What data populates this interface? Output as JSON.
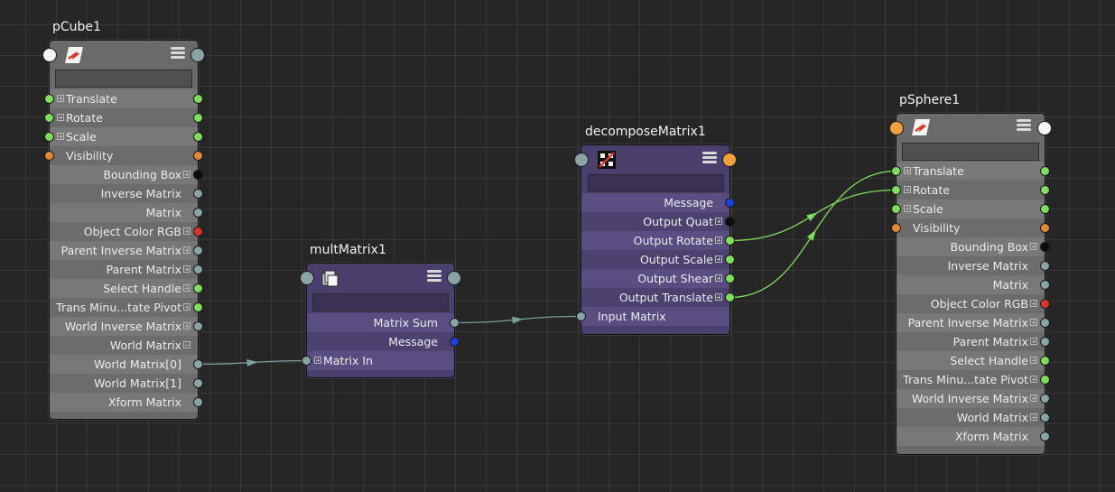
{
  "colors": {
    "background": "#262626",
    "node_grey": "#6a6a6a",
    "node_purple": "#4b3f6d",
    "wire_matrix": "#7a9ea0",
    "wire_vector": "#7fdc5c"
  },
  "nodes": {
    "pCube1": {
      "title": "pCube1",
      "icon": "transform-icon",
      "attributes": [
        {
          "label": "Translate",
          "align": "left",
          "expand": "plus",
          "in": "green",
          "out": "green"
        },
        {
          "label": "Rotate",
          "align": "left",
          "expand": "plus",
          "in": "green",
          "out": "green"
        },
        {
          "label": "Scale",
          "align": "left",
          "expand": "plus",
          "in": "green",
          "out": "green"
        },
        {
          "label": "Visibility",
          "align": "left",
          "expand": "",
          "in": "orange",
          "out": "orange"
        },
        {
          "label": "Bounding Box",
          "align": "right",
          "expand": "plus",
          "in": "",
          "out": "black"
        },
        {
          "label": "Inverse Matrix",
          "align": "right",
          "expand": "",
          "in": "",
          "out": "grey"
        },
        {
          "label": "Matrix",
          "align": "right",
          "expand": "",
          "in": "",
          "out": "grey"
        },
        {
          "label": "Object Color RGB",
          "align": "right",
          "expand": "plus",
          "in": "",
          "out": "red"
        },
        {
          "label": "Parent Inverse Matrix",
          "align": "right",
          "expand": "plus",
          "in": "",
          "out": "grey"
        },
        {
          "label": "Parent Matrix",
          "align": "right",
          "expand": "plus",
          "in": "",
          "out": "grey"
        },
        {
          "label": "Select Handle",
          "align": "right",
          "expand": "plus",
          "in": "",
          "out": "green"
        },
        {
          "label": "Trans Minu...tate Pivot",
          "align": "right",
          "expand": "plus",
          "in": "",
          "out": "green"
        },
        {
          "label": "World Inverse Matrix",
          "align": "right",
          "expand": "plus",
          "in": "",
          "out": "grey"
        },
        {
          "label": "World Matrix",
          "align": "right",
          "expand": "minus",
          "in": "",
          "out": ""
        },
        {
          "label": "World Matrix[0]",
          "align": "right",
          "expand": "",
          "in": "",
          "out": "grey"
        },
        {
          "label": "World Matrix[1]",
          "align": "right",
          "expand": "",
          "in": "",
          "out": "grey"
        },
        {
          "label": "Xform Matrix",
          "align": "right",
          "expand": "",
          "in": "",
          "out": "grey"
        }
      ]
    },
    "multMatrix1": {
      "title": "multMatrix1",
      "icon": "mult-matrix-icon",
      "attributes": [
        {
          "label": "Matrix Sum",
          "align": "right",
          "expand": "",
          "in": "",
          "out": "grey"
        },
        {
          "label": "Message",
          "align": "right",
          "expand": "",
          "in": "",
          "out": "blue"
        },
        {
          "label": "Matrix In",
          "align": "left",
          "expand": "plus",
          "in": "grey",
          "out": ""
        }
      ]
    },
    "decomposeMatrix1": {
      "title": "decomposeMatrix1",
      "icon": "decompose-matrix-icon",
      "attributes": [
        {
          "label": "Message",
          "align": "right",
          "expand": "",
          "in": "",
          "out": "blue"
        },
        {
          "label": "Output Quat",
          "align": "right",
          "expand": "plus",
          "in": "",
          "out": "black"
        },
        {
          "label": "Output Rotate",
          "align": "right",
          "expand": "plus",
          "in": "",
          "out": "green"
        },
        {
          "label": "Output Scale",
          "align": "right",
          "expand": "plus",
          "in": "",
          "out": "green"
        },
        {
          "label": "Output Shear",
          "align": "right",
          "expand": "plus",
          "in": "",
          "out": "green"
        },
        {
          "label": "Output Translate",
          "align": "right",
          "expand": "plus",
          "in": "",
          "out": "green"
        },
        {
          "label": "Input Matrix",
          "align": "left",
          "expand": "",
          "in": "grey",
          "out": ""
        }
      ]
    },
    "pSphere1": {
      "title": "pSphere1",
      "icon": "transform-icon",
      "attributes": [
        {
          "label": "Translate",
          "align": "left",
          "expand": "plus",
          "in": "green",
          "out": "green"
        },
        {
          "label": "Rotate",
          "align": "left",
          "expand": "plus",
          "in": "green",
          "out": "green"
        },
        {
          "label": "Scale",
          "align": "left",
          "expand": "plus",
          "in": "green",
          "out": "green"
        },
        {
          "label": "Visibility",
          "align": "left",
          "expand": "",
          "in": "orange",
          "out": "orange"
        },
        {
          "label": "Bounding Box",
          "align": "right",
          "expand": "plus",
          "in": "",
          "out": "black"
        },
        {
          "label": "Inverse Matrix",
          "align": "right",
          "expand": "",
          "in": "",
          "out": "grey"
        },
        {
          "label": "Matrix",
          "align": "right",
          "expand": "",
          "in": "",
          "out": "grey"
        },
        {
          "label": "Object Color RGB",
          "align": "right",
          "expand": "plus",
          "in": "",
          "out": "red"
        },
        {
          "label": "Parent Inverse Matrix",
          "align": "right",
          "expand": "plus",
          "in": "",
          "out": "grey"
        },
        {
          "label": "Parent Matrix",
          "align": "right",
          "expand": "plus",
          "in": "",
          "out": "grey"
        },
        {
          "label": "Select Handle",
          "align": "right",
          "expand": "plus",
          "in": "",
          "out": "green"
        },
        {
          "label": "Trans Minu...tate Pivot",
          "align": "right",
          "expand": "plus",
          "in": "",
          "out": "green"
        },
        {
          "label": "World Inverse Matrix",
          "align": "right",
          "expand": "plus",
          "in": "",
          "out": "grey"
        },
        {
          "label": "World Matrix",
          "align": "right",
          "expand": "plus",
          "in": "",
          "out": "grey"
        },
        {
          "label": "Xform Matrix",
          "align": "right",
          "expand": "",
          "in": "",
          "out": "grey"
        }
      ]
    }
  },
  "connections": [
    {
      "from": "pCube1.World Matrix[0]",
      "to": "multMatrix1.Matrix In",
      "type": "matrix"
    },
    {
      "from": "multMatrix1.Matrix Sum",
      "to": "decomposeMatrix1.Input Matrix",
      "type": "matrix"
    },
    {
      "from": "decomposeMatrix1.Output Translate",
      "to": "pSphere1.Translate",
      "type": "vector"
    },
    {
      "from": "decomposeMatrix1.Output Rotate",
      "to": "pSphere1.Rotate",
      "type": "vector"
    }
  ]
}
